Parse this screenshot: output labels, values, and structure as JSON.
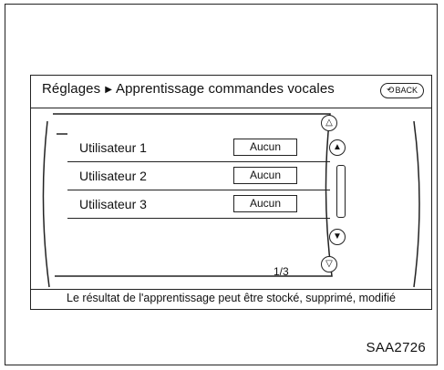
{
  "header": {
    "breadcrumb_root": "Réglages",
    "breadcrumb_current": "Apprentissage commandes vocales",
    "back_label": "BACK"
  },
  "users": [
    {
      "label": "Utilisateur 1",
      "value": "Aucun"
    },
    {
      "label": "Utilisateur 2",
      "value": "Aucun"
    },
    {
      "label": "Utilisateur 3",
      "value": "Aucun"
    }
  ],
  "pagination": {
    "indicator": "1/3"
  },
  "status_text": "Le résultat de l'apprentissage peut être stocké, supprimé, modifié",
  "figure_code": "SAA2726",
  "icons": {
    "breadcrumb_separator": "triangle-right-icon",
    "back": "back-arrow-icon",
    "page_up": "double-chevron-up-icon",
    "line_up": "chevron-up-icon",
    "line_down": "chevron-down-icon",
    "page_down": "double-chevron-down-icon"
  }
}
